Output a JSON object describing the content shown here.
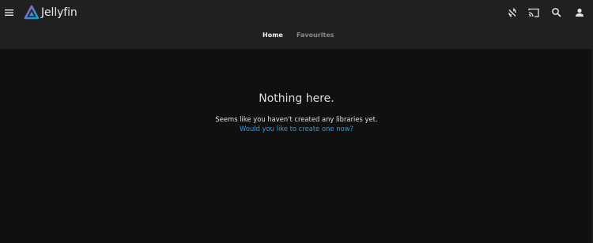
{
  "app": {
    "name": "Jellyfin"
  },
  "header": {
    "menu_icon": "hamburger-menu-icon",
    "logo_icon": "jellyfin-logo-icon",
    "actions": [
      {
        "name": "sync-disabled-icon"
      },
      {
        "name": "cast-icon"
      },
      {
        "name": "search-icon"
      },
      {
        "name": "user-icon"
      }
    ]
  },
  "tabs": [
    {
      "label": "Home",
      "active": true
    },
    {
      "label": "Favourites",
      "active": false
    }
  ],
  "empty_state": {
    "title": "Nothing here.",
    "description": "Seems like you haven't created any libraries yet.",
    "link_text": "Would you like to create one now?"
  },
  "colors": {
    "header_bg": "#202020",
    "page_bg": "#101010",
    "link": "#2c9cdc",
    "accent_purple": "#aa5cc3",
    "accent_blue": "#00a4dc"
  }
}
